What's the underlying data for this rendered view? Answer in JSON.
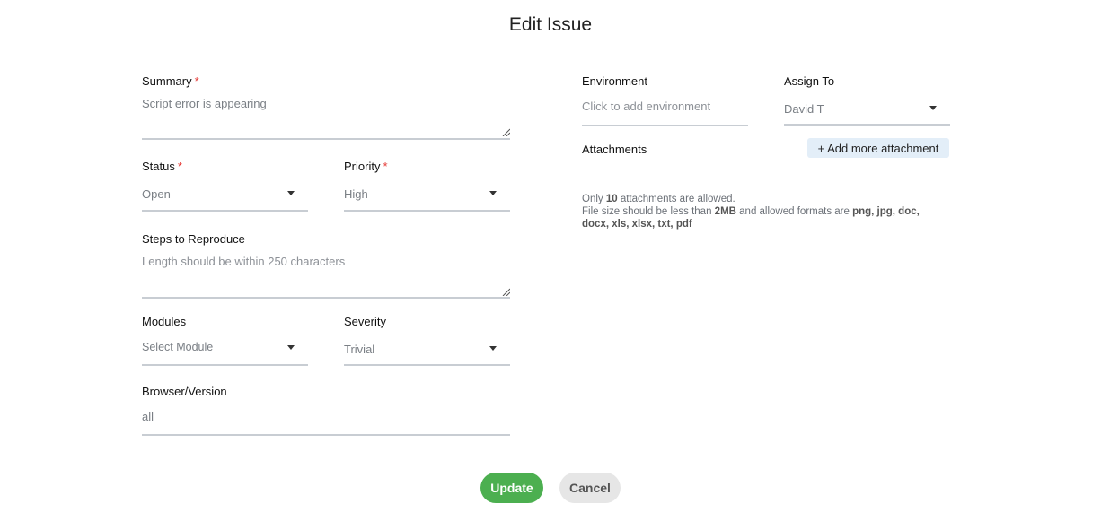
{
  "title": "Edit Issue",
  "required_mark": "*",
  "summary": {
    "label": "Summary",
    "value": "Script error is appearing"
  },
  "status": {
    "label": "Status",
    "value": "Open"
  },
  "priority": {
    "label": "Priority",
    "value": "High"
  },
  "steps": {
    "label": "Steps to Reproduce",
    "placeholder": "Length should be within 250 characters"
  },
  "modules": {
    "label": "Modules",
    "placeholder": "Select Module"
  },
  "severity": {
    "label": "Severity",
    "value": "Trivial"
  },
  "browser": {
    "label": "Browser/Version",
    "value": "all"
  },
  "environment": {
    "label": "Environment",
    "placeholder": "Click to add environment"
  },
  "assign_to": {
    "label": "Assign To",
    "value": "David T"
  },
  "attachments": {
    "label": "Attachments",
    "add_button": "+ Add more attachment",
    "note_line1_prefix": "Only ",
    "note_count": "10",
    "note_line1_suffix": " attachments are allowed.",
    "note_line2_prefix": "File size should be less than ",
    "note_size": "2MB",
    "note_line2_mid": " and allowed formats are ",
    "note_formats": "png, jpg, doc, docx, xls, xlsx, txt, pdf"
  },
  "buttons": {
    "update": "Update",
    "cancel": "Cancel"
  },
  "colors": {
    "accent_green": "#4caf50",
    "required_red": "#e53935",
    "attach_bg": "#e3eef8"
  }
}
